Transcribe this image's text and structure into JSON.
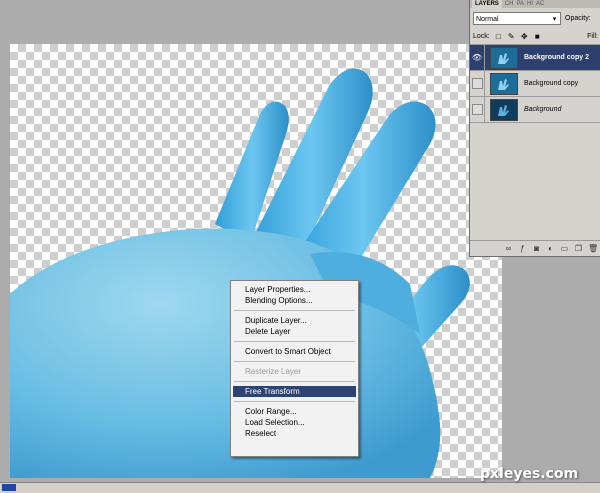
{
  "layers_panel": {
    "tabs": [
      "LAYERS",
      "CH",
      "PA",
      "HI",
      "AC"
    ],
    "blend_mode": "Normal",
    "opacity_label": "Opacity:",
    "lock_label": "Lock:",
    "fill_label": "Fill:",
    "layers": [
      {
        "name": "Background copy 2",
        "selected": true,
        "visible": true
      },
      {
        "name": "Background copy",
        "selected": false,
        "visible": false
      },
      {
        "name": "Background",
        "selected": false,
        "visible": false
      }
    ],
    "bottom_icons": [
      "link-icon",
      "fx-icon",
      "mask-icon",
      "adjustment-icon",
      "folder-icon",
      "new-layer-icon",
      "trash-icon"
    ]
  },
  "context_menu": {
    "groups": [
      [
        "Layer Properties...",
        "Blending Options..."
      ],
      [
        "Duplicate Layer...",
        "Delete Layer"
      ],
      [
        "Convert to Smart Object"
      ],
      [
        "Rasterize Layer"
      ],
      [
        "Free Transform"
      ],
      [
        "Color Range...",
        "Load Selection...",
        "Reselect"
      ]
    ],
    "disabled": [
      "Rasterize Layer"
    ],
    "highlighted": "Free Transform"
  },
  "watermark": "pxleyes.com",
  "colors": {
    "selection": "#2d4373",
    "glove_blue": "#4fb3e6",
    "workspace": "#acacac"
  }
}
